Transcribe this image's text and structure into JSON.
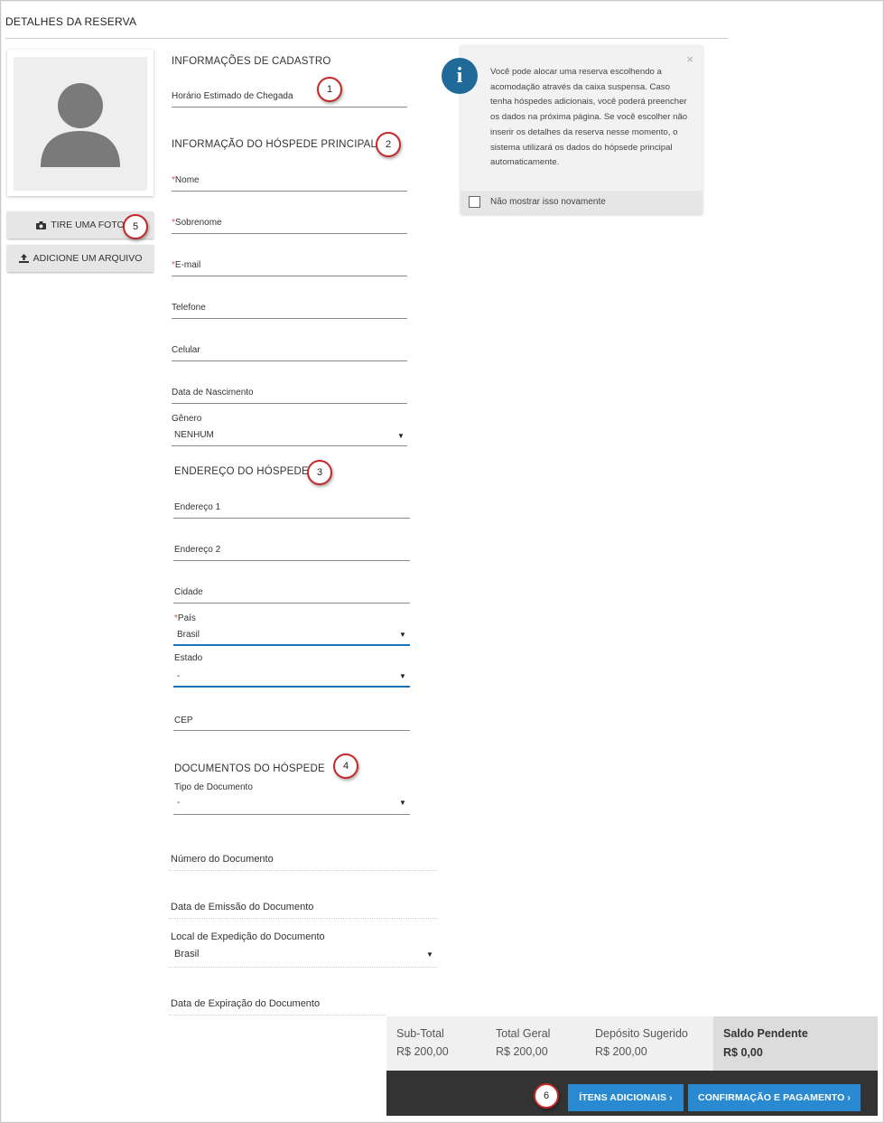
{
  "page": {
    "title": "DETALHES DA RESERVA"
  },
  "photo": {
    "take_photo_label": "TIRE UMA FOTO",
    "add_file_label": "ADICIONE UM ARQUIVO"
  },
  "registration": {
    "heading": "INFORMAÇÕES DE CADASTRO",
    "arrival_time_label": "Horário Estimado de Chegada"
  },
  "main_guest": {
    "heading": "INFORMAÇÃO DO HÓSPEDE PRINCIPAL",
    "first_name_label": "Nome",
    "last_name_label": "Sobrenome",
    "email_label": "E-mail",
    "phone_label": "Telefone",
    "mobile_label": "Celular",
    "birth_date_label": "Data de Nascimento",
    "gender_label": "Gênero",
    "gender_value": "NENHUM"
  },
  "address": {
    "heading": "ENDEREÇO DO HÓSPEDE",
    "address1_label": "Endereço 1",
    "address2_label": "Endereço 2",
    "city_label": "Cidade",
    "country_label": "País",
    "country_value": "Brasil",
    "state_label": "Estado",
    "state_value": "-",
    "zip_label": "CEP"
  },
  "documents": {
    "heading": "DOCUMENTOS DO HÓSPEDE",
    "doc_type_label": "Tipo de Documento",
    "doc_type_value": "-",
    "doc_number_label": "Número do Documento",
    "issue_date_label": "Data de Emissão do Documento",
    "issue_place_label": "Local de Expedição do Documento",
    "issue_place_value": "Brasil",
    "expiry_date_label": "Data de Expiração do Documento"
  },
  "required_mark": "*",
  "markers": [
    "1",
    "2",
    "3",
    "4",
    "5",
    "6"
  ],
  "info": {
    "text": "Você pode alocar uma reserva escolhendo a acomodação através da caixa suspensa. Caso tenha hóspedes adicionais, você poderá preencher os dados na próxima página. Se você escolher não inserir os detalhes da reserva nesse momento, o sistema utilizará os dados do hópsede principal automaticamente.",
    "dont_show_label": "Não mostrar isso novamente",
    "close_glyph": "×",
    "icon_glyph": "i"
  },
  "totals": {
    "subtotal_label": "Sub-Total",
    "subtotal_value": "R$ 200,00",
    "grand_total_label": "Total Geral",
    "grand_total_value": "R$ 200,00",
    "deposit_label": "Depósito Sugerido",
    "deposit_value": "R$ 200,00",
    "pending_label": "Saldo Pendente",
    "pending_value": "R$ 0,00"
  },
  "actions": {
    "additional_items_label": "ÍTENS ADICIONAIS ›",
    "confirm_payment_label": "CONFIRMAÇÃO E PAGAMENTO ›"
  },
  "colors": {
    "accent_blue": "#2a8ad1",
    "marker_red": "#c62828",
    "info_blue": "#1f6a98",
    "required_red": "#d9534f",
    "action_bar": "#333333"
  }
}
